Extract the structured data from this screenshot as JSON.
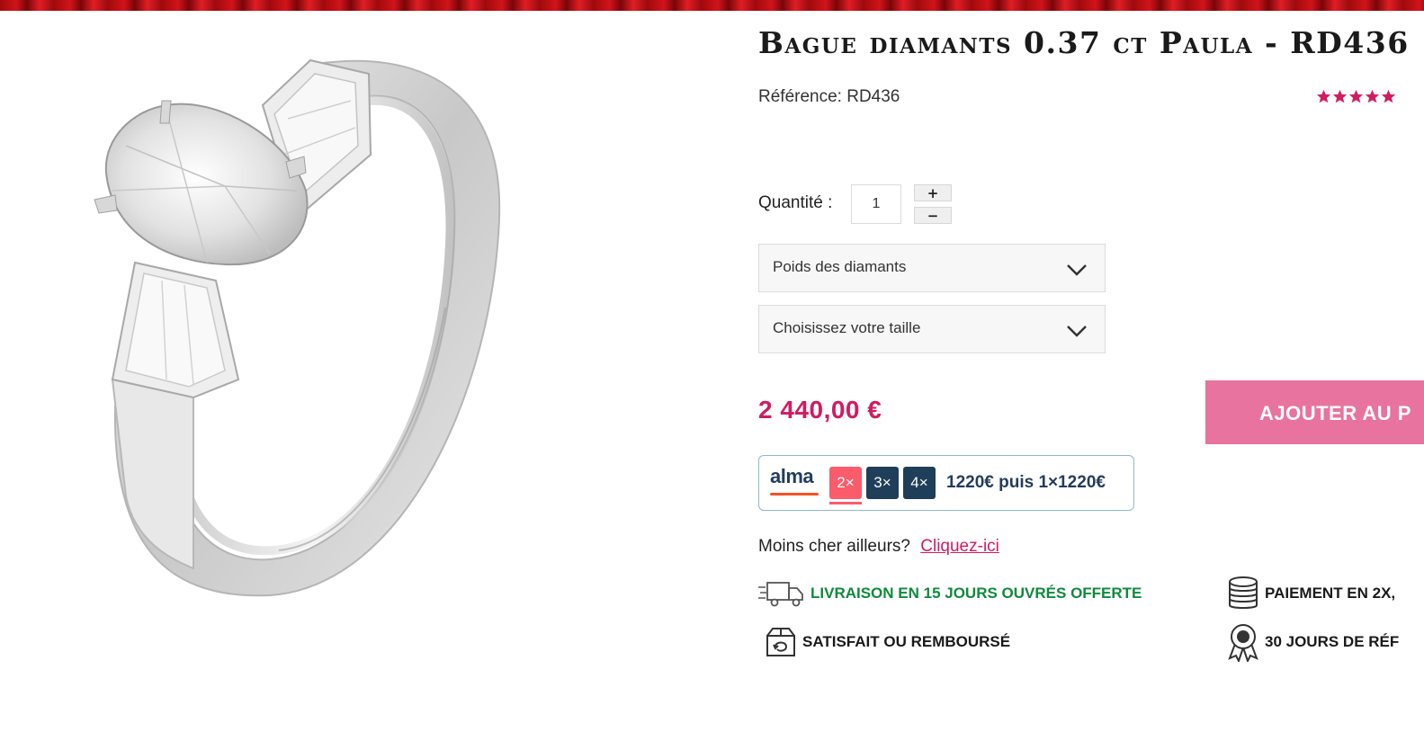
{
  "product": {
    "title": "Bague diamants 0.37 ct Paula - RD436",
    "reference_label": "Référence:",
    "reference_value": "RD436",
    "rating_stars": 5,
    "rating_color": "#d11b62",
    "image_alt": "bague-diamant-solitaire-poire-baguettes"
  },
  "quantity": {
    "label": "Quantité :",
    "value": "1",
    "plus": "+",
    "minus": "−"
  },
  "selects": {
    "weight_label": "Poids des diamants",
    "size_label": "Choisissez votre taille"
  },
  "price": {
    "amount": "2 440,00 €",
    "color": "#d11b62"
  },
  "cart": {
    "button_label": "AJOUTER AU P",
    "color": "#e8739e"
  },
  "alma": {
    "logo": "alma",
    "options": [
      "2×",
      "3×",
      "4×"
    ],
    "selected": "2×",
    "installments_text": "1220€ puis 1×1220€"
  },
  "cheaper": {
    "question": "Moins cher ailleurs?",
    "link": "Cliquez-ici"
  },
  "features": {
    "delivery": "LIVRAISON EN 15 JOURS OUVRÉS OFFERTE",
    "delivery_icon": "delivery-truck-icon",
    "satisfied": "SATISFAIT OU REMBOURSÉ",
    "satisfied_icon": "return-box-icon",
    "payment": "PAIEMENT EN 2X,",
    "payment_icon": "coin-stack-icon",
    "thirty_days": "30 JOURS DE RÉF",
    "thirty_days_icon": "award-rosette-icon",
    "delivery_color": "#0f8a3c"
  }
}
